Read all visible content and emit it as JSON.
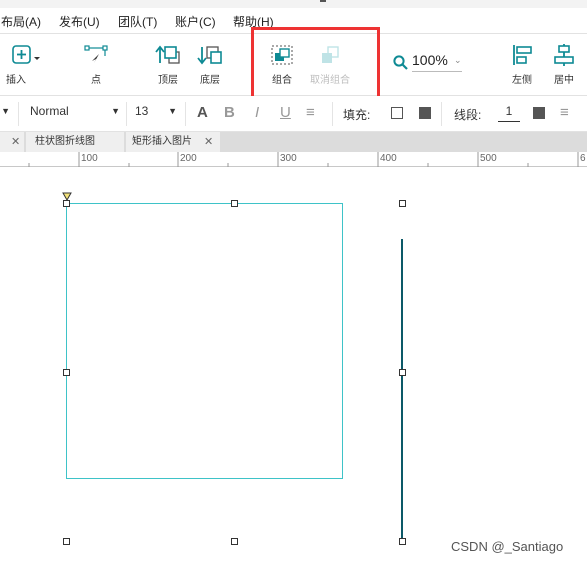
{
  "menubar": {
    "items": [
      "布局(A)",
      "发布(U)",
      "团队(T)",
      "账户(C)",
      "帮助(H)"
    ]
  },
  "toolbar": {
    "insert": "插入",
    "point": "点",
    "to_front": "顶层",
    "to_back": "底层",
    "group": "组合",
    "ungroup": "取消组合",
    "zoom": "100%",
    "align_left": "左侧",
    "align_center": "居中"
  },
  "format": {
    "font_style": "Normal",
    "font_size": "13",
    "fill_label": "填充:",
    "line_label": "线段:",
    "line_width": "1"
  },
  "tabs": [
    {
      "label": "柱状图折线图"
    },
    {
      "label": "矩形插入图片"
    }
  ],
  "ruler": {
    "ticks": [
      "100",
      "200",
      "300",
      "400",
      "500",
      "6"
    ]
  },
  "watermark": "CSDN @_Santiago",
  "colors": {
    "accent": "#0e8a94",
    "highlight": "#e33333",
    "rect_border": "#3ec3c8",
    "line": "#0c5968"
  }
}
